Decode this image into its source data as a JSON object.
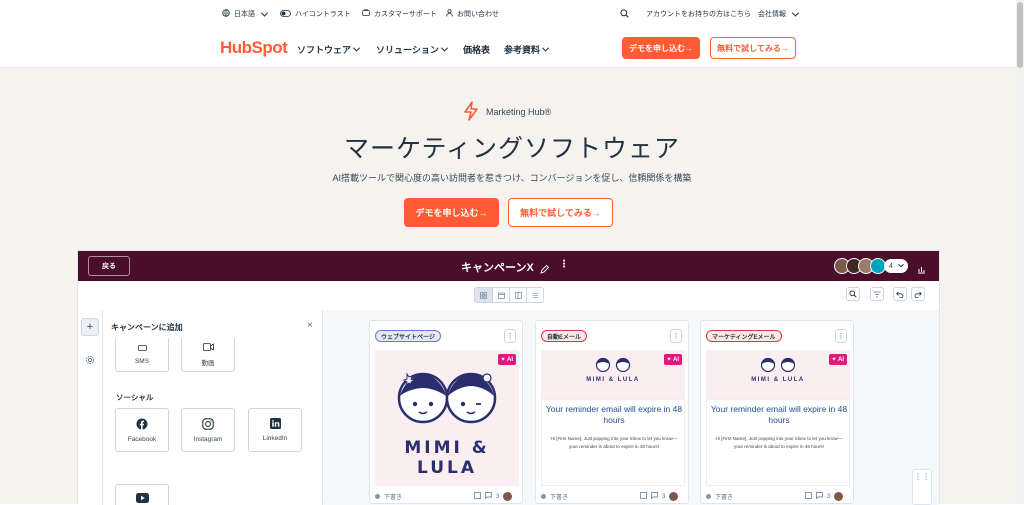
{
  "utility_bar": {
    "language": "日本語",
    "contrast": "ハイコントラスト",
    "support": "カスタマーサポート",
    "contact": "お問い合わせ",
    "account": "アカウントをお持ちの方はこちら",
    "company": "会社情報"
  },
  "nav": {
    "logo": "HubSpot",
    "items": [
      "ソフトウェア",
      "ソリューション",
      "価格表",
      "参考資料"
    ],
    "demo_button": "デモを申し込む→",
    "trial_button": "無料で試してみる→"
  },
  "hero": {
    "product": "Marketing Hub®",
    "title": "マーケティングソフトウェア",
    "subtitle": "AI搭載ツールで関心度の高い訪問者を惹きつけ、コンバージョンを促し、信頼関係を構築",
    "demo_button": "デモを申し込む→",
    "trial_button": "無料で試してみる→"
  },
  "app": {
    "back_button": "戻る",
    "campaign_title": "キャンペーンX",
    "avatar_count": "4",
    "panel": {
      "title": "キャンペーンに追加",
      "top_items": [
        "SMS",
        "動画"
      ],
      "social_heading": "ソーシャル",
      "social_items": [
        "Facebook",
        "Instagram",
        "LinkedIn"
      ]
    },
    "cards": [
      {
        "tag": "ウェブサイトページ",
        "tag_color": "#e5e8fb",
        "ai": "✦ AI",
        "brand": "MIMI & LULA",
        "status": "下書き",
        "comments": "3"
      },
      {
        "tag": "自動Eメール",
        "tag_color": "#fde8e8",
        "ai": "✦ AI",
        "brand": "MIMI & LULA",
        "email_title": "Your reminder email will expire in 48 hours",
        "email_body": "Hi [First Name], Just popping into your inbox to let you know—your reminder is about to expire in 48 hours!",
        "status": "下書き",
        "comments": "3"
      },
      {
        "tag": "マーケティングEメール",
        "tag_color": "#fde8e8",
        "ai": "✦ AI",
        "brand": "MIMI & LULA",
        "email_title": "Your reminder email will expire in 48 hours",
        "email_body": "Hi [First Name], Just popping into your inbox to let you know—your reminder is about to expire in 48 hours!",
        "status": "下書き",
        "comments": "3"
      }
    ]
  },
  "colors": {
    "brand_orange": "#ff5c35",
    "app_header": "#4a0d2a",
    "hero_bg": "#f6f3ee"
  }
}
